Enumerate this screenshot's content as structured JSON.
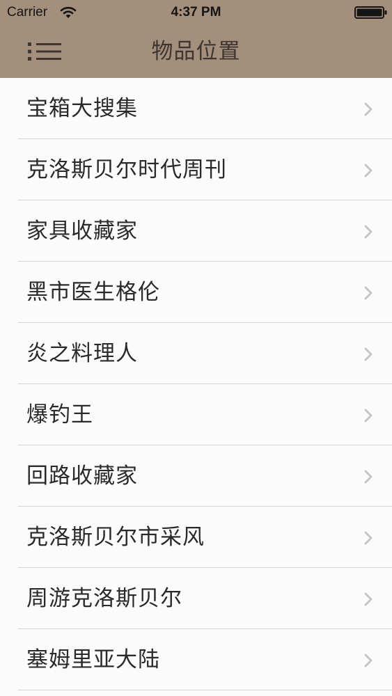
{
  "status_bar": {
    "carrier": "Carrier",
    "time": "4:37 PM"
  },
  "nav": {
    "title": "物品位置",
    "menu_icon": "hamburger-list-icon",
    "background_color": "#a48e7c"
  },
  "list": {
    "chevron_icon": "chevron-right-icon",
    "items": [
      {
        "label": "宝箱大搜集"
      },
      {
        "label": "克洛斯贝尔时代周刊"
      },
      {
        "label": "家具收藏家"
      },
      {
        "label": "黑市医生格伦"
      },
      {
        "label": "炎之料理人"
      },
      {
        "label": "爆钓王"
      },
      {
        "label": "回路收藏家"
      },
      {
        "label": "克洛斯贝尔市采风"
      },
      {
        "label": "周游克洛斯贝尔"
      },
      {
        "label": "塞姆里亚大陆"
      }
    ]
  }
}
